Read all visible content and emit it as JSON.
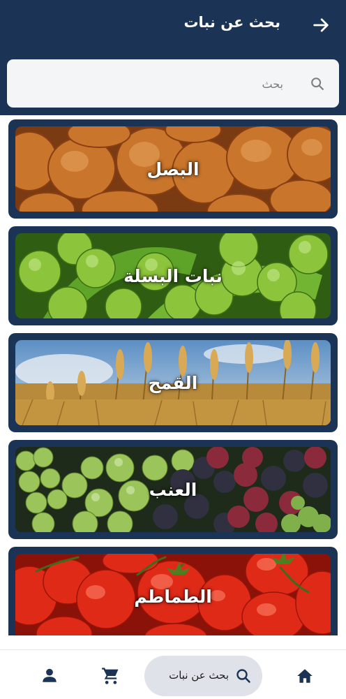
{
  "header": {
    "title": "بحث عن نبات"
  },
  "search": {
    "placeholder": "بحث"
  },
  "plants": [
    {
      "name": "البصل"
    },
    {
      "name": "نبات البسلة"
    },
    {
      "name": "القمح"
    },
    {
      "name": "العنب"
    },
    {
      "name": "الطماطم"
    }
  ],
  "bottom_nav": {
    "search_label": "بحث عن نبات",
    "items": [
      "home-icon",
      "search-icon",
      "cart-icon",
      "account-icon"
    ]
  },
  "colors": {
    "primary": "#1b3354",
    "pill": "#dfe2e8",
    "search_bg": "#f4f5f7"
  }
}
